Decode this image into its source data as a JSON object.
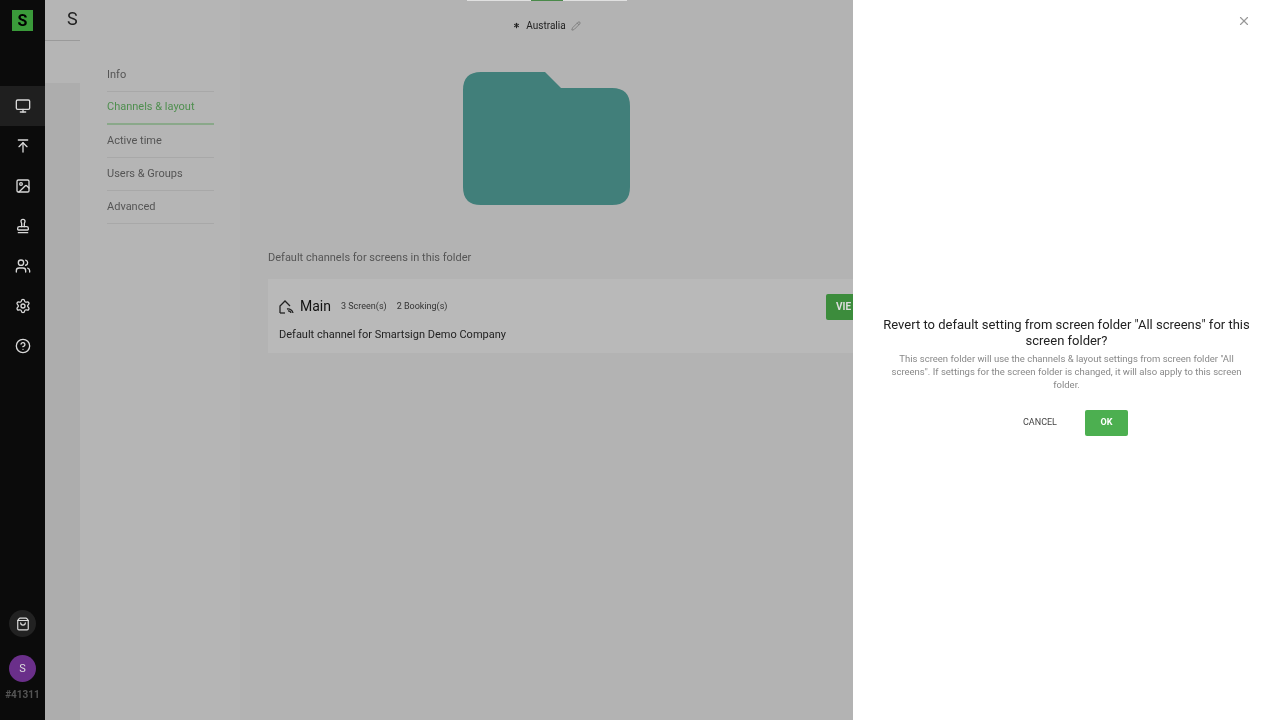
{
  "sidebar": {
    "logo": "S",
    "items": [
      {
        "kind": "monitor",
        "selected": true
      },
      {
        "kind": "upload",
        "selected": false
      },
      {
        "kind": "image",
        "selected": false
      },
      {
        "kind": "stamp",
        "selected": false
      },
      {
        "kind": "users",
        "selected": false
      },
      {
        "kind": "settings",
        "selected": false
      },
      {
        "kind": "help",
        "selected": false
      }
    ],
    "avatar": "S",
    "account_id": "#41311"
  },
  "header_title": "S",
  "folder_menu": [
    {
      "label": "Info",
      "selected": false
    },
    {
      "label": "Channels & layout",
      "selected": true
    },
    {
      "label": "Active time",
      "selected": false
    },
    {
      "label": "Users & Groups",
      "selected": false
    },
    {
      "label": "Advanced",
      "selected": false
    }
  ],
  "folder_name": "Australia",
  "section_title": "Default channels for screens in this folder",
  "channel": {
    "name": "Main",
    "screens": "3 Screen(s)",
    "bookings": "2 Booking(s)",
    "description": "Default channel for Smartsign Demo Company",
    "button": "VIE"
  },
  "dialog": {
    "title": "Revert to default setting from screen folder \"All screens\" for this screen folder?",
    "message": "This screen folder will use the channels & layout settings from screen folder \"All screens\". If settings for the screen folder is changed, it will also apply to this screen folder.",
    "cancel": "CANCEL",
    "ok": "OK"
  }
}
